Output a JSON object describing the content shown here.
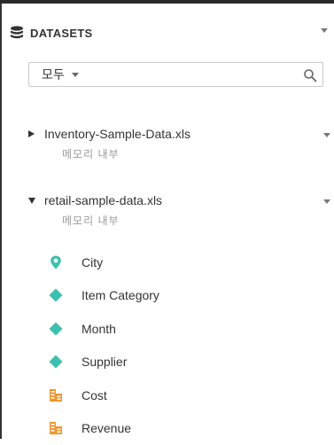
{
  "header": {
    "title": "DATASETS",
    "icon": "database-icon"
  },
  "search": {
    "selected_scope": "모두",
    "icon": "search-icon"
  },
  "datasets": [
    {
      "name": "Inventory-Sample-Data.xls",
      "subtitle": "메모리 내부",
      "expanded": false
    },
    {
      "name": "retail-sample-data.xls",
      "subtitle": "메모리 내부",
      "expanded": true,
      "fields": [
        {
          "label": "City",
          "icon": "geo-pin-icon",
          "kind": "geo"
        },
        {
          "label": "Item Category",
          "icon": "dimension-diamond-icon",
          "kind": "dimension"
        },
        {
          "label": "Month",
          "icon": "dimension-diamond-icon",
          "kind": "dimension"
        },
        {
          "label": "Supplier",
          "icon": "dimension-diamond-icon",
          "kind": "dimension"
        },
        {
          "label": "Cost",
          "icon": "measure-icon",
          "kind": "measure"
        },
        {
          "label": "Revenue",
          "icon": "measure-icon",
          "kind": "measure"
        }
      ]
    }
  ],
  "colors": {
    "dimension": "#3cbfae",
    "measure": "#f0962f",
    "header_text": "#333333",
    "sub_text": "#999999"
  }
}
